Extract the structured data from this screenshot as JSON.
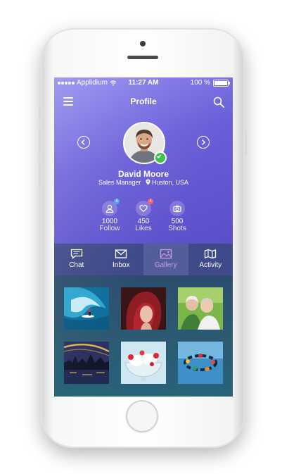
{
  "status_bar": {
    "carrier": "Applidium",
    "time": "11:27 AM",
    "battery": "100 %"
  },
  "header": {
    "title": "Profile"
  },
  "profile": {
    "name": "David Moore",
    "role": "Sales Manager",
    "location": "Huston, USA",
    "online": true
  },
  "stats": [
    {
      "value": "1000",
      "label": "Follow",
      "badge": "4",
      "icon": "user-icon",
      "badge_color": "#4aa3ff"
    },
    {
      "value": "450",
      "label": "Likes",
      "badge": "4",
      "icon": "heart-icon",
      "badge_color": "#ff5a6e"
    },
    {
      "value": "500",
      "label": "Shots",
      "badge": "",
      "icon": "camera-icon",
      "badge_color": ""
    }
  ],
  "tabs": [
    {
      "label": "Chat",
      "icon": "chat-icon",
      "active": false
    },
    {
      "label": "Inbox",
      "icon": "inbox-icon",
      "active": false
    },
    {
      "label": "Gallery",
      "icon": "gallery-icon",
      "active": true
    },
    {
      "label": "Activity",
      "icon": "map-icon",
      "active": false
    }
  ],
  "gallery": [
    {
      "subject": "surfer-wave"
    },
    {
      "subject": "red-hair-woman"
    },
    {
      "subject": "elderly-couple"
    },
    {
      "subject": "city-bridge-night"
    },
    {
      "subject": "ice-cream-dessert"
    },
    {
      "subject": "skydivers"
    }
  ],
  "colors": {
    "accent": "#c99be6",
    "hero_top": "#8a86ee",
    "hero_bottom": "#5b4fc9",
    "tabbar": "#3e4a89",
    "online": "#3bbf4a"
  }
}
